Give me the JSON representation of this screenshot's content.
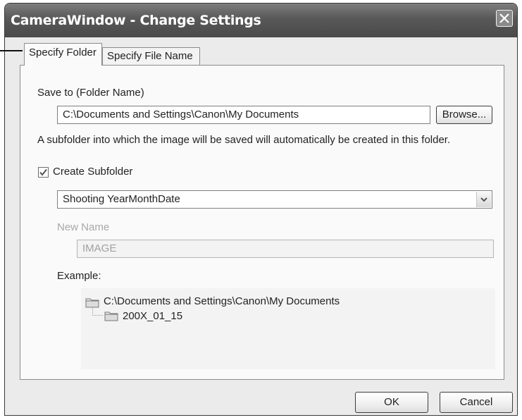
{
  "window": {
    "title": "CameraWindow - Change Settings"
  },
  "tabs": [
    {
      "label": "Specify Folder",
      "active": true
    },
    {
      "label": "Specify File Name",
      "active": false
    }
  ],
  "save_to": {
    "label": "Save to (Folder Name)",
    "value": "C:\\Documents and Settings\\Canon\\My Documents",
    "browse_label": "Browse..."
  },
  "info_text": "A subfolder into which the image will be saved will automatically be created in this folder.",
  "subfolder": {
    "checkbox_label": "Create Subfolder",
    "checked": true,
    "selected_option": "Shooting YearMonthDate"
  },
  "new_name": {
    "label": "New Name",
    "value": "IMAGE"
  },
  "example": {
    "label": "Example:",
    "root": "C:\\Documents and Settings\\Canon\\My Documents",
    "child": "200X_01_15"
  },
  "footer": {
    "ok_label": "OK",
    "cancel_label": "Cancel"
  }
}
